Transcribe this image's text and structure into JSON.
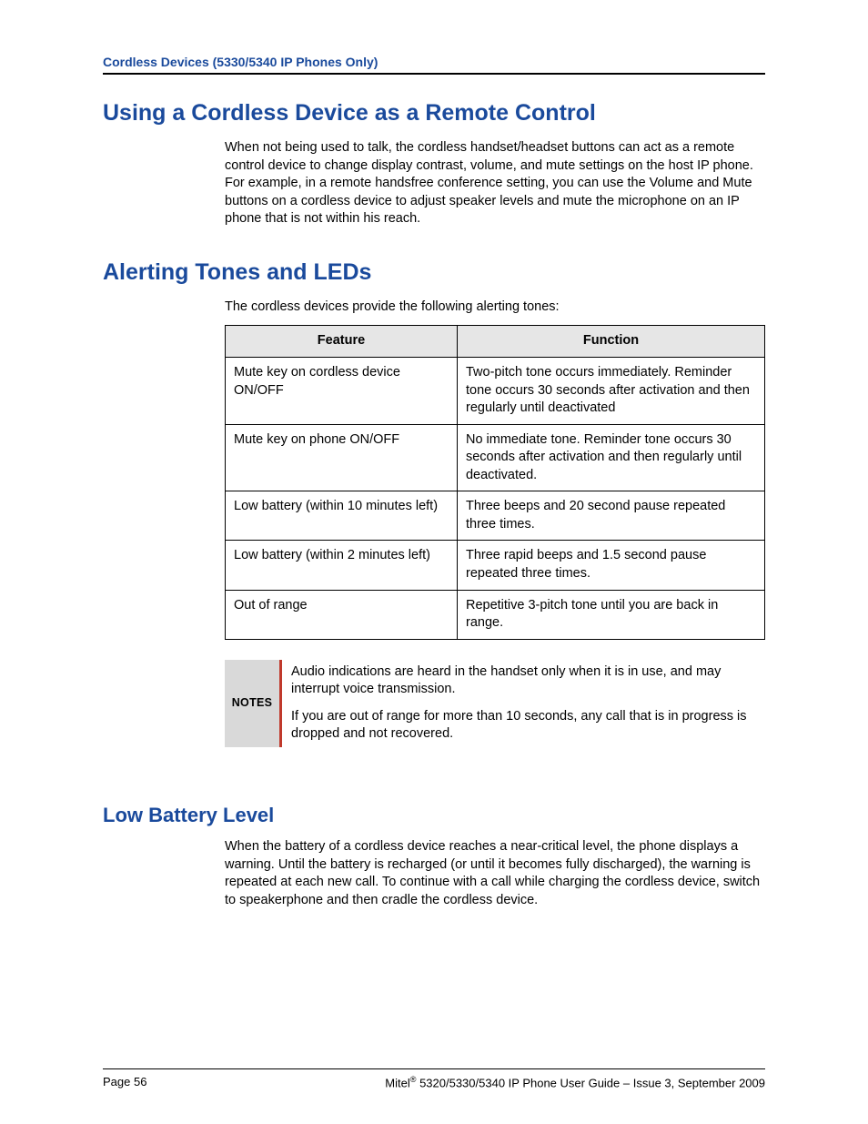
{
  "header": {
    "running": "Cordless Devices (5330/5340 IP Phones Only)"
  },
  "sections": {
    "s1": {
      "title": "Using a Cordless Device as a Remote Control",
      "p1": "When not being used to talk, the cordless handset/headset buttons can act as a remote control device to change display contrast, volume, and mute settings on the host IP phone. For example, in a remote handsfree conference setting, you can use the Volume and Mute buttons on a cordless device to adjust speaker levels and mute the microphone on an IP phone that is not within his reach."
    },
    "s2": {
      "title": "Alerting Tones and LEDs",
      "intro": "The cordless devices provide the following alerting tones:",
      "table": {
        "head": {
          "c1": "Feature",
          "c2": "Function"
        },
        "rows": [
          {
            "c1": "Mute key on cordless device ON/OFF",
            "c2": "Two-pitch tone occurs immediately. Reminder tone occurs 30 seconds after activation and then regularly until deactivated"
          },
          {
            "c1": "Mute key on phone ON/OFF",
            "c2": "No immediate tone. Reminder tone occurs 30 seconds after activation and then regularly until deactivated."
          },
          {
            "c1": "Low battery (within 10 minutes left)",
            "c2": "Three beeps and 20 second pause repeated three times."
          },
          {
            "c1": "Low battery (within 2 minutes left)",
            "c2": "Three rapid beeps and 1.5 second pause repeated three times."
          },
          {
            "c1": "Out of range",
            "c2": "Repetitive 3-pitch tone until you are back in range."
          }
        ]
      },
      "notes": {
        "label": "NOTES",
        "p1": "Audio indications are heard in the handset only when it is in use, and may interrupt voice transmission.",
        "p2": "If you are out of range for more than 10 seconds, any call that is in progress is dropped and not recovered."
      }
    },
    "s3": {
      "title": "Low Battery Level",
      "p1": "When the battery of a cordless device reaches a near-critical level, the phone displays a warning. Until the battery is recharged (or until it becomes fully discharged), the warning is repeated at each new call. To continue with a call while charging the cordless device, switch to speakerphone and then cradle the cordless device."
    }
  },
  "footer": {
    "page_label": "Page 56",
    "brand_pre": "Mitel",
    "brand_sup": "®",
    "doc": " 5320/5330/5340 IP Phone User Guide – Issue 3, September 2009"
  }
}
